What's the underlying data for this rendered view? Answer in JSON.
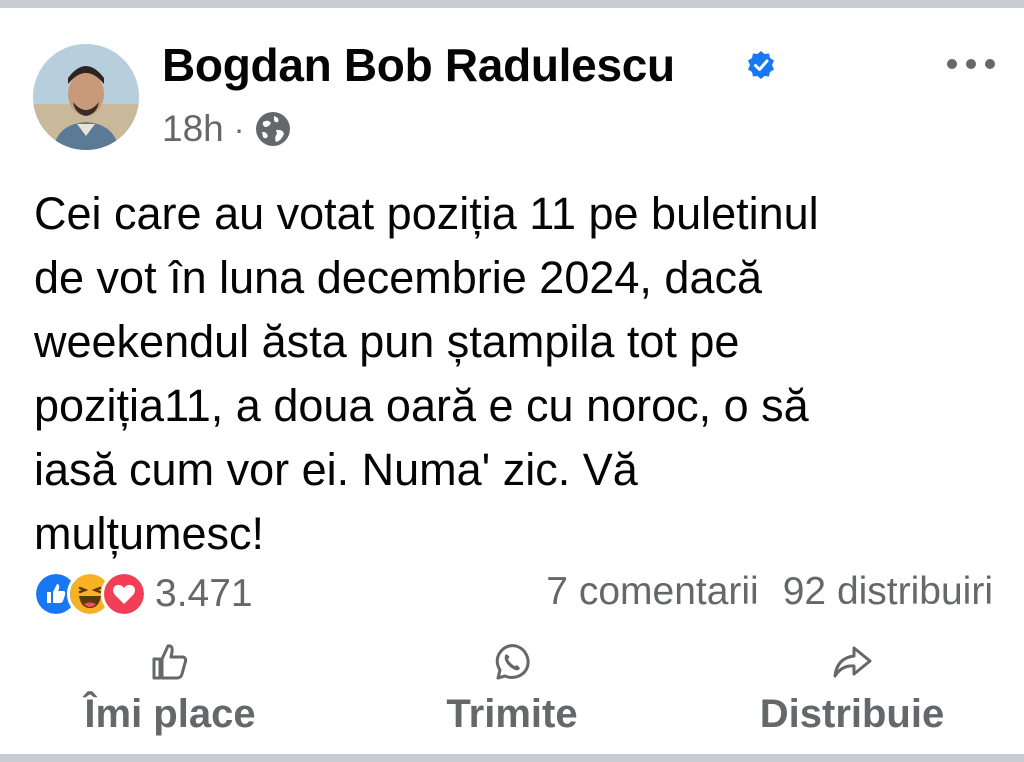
{
  "post": {
    "author": "Bogdan Bob Radulescu",
    "verified": true,
    "time": "18h",
    "separator": "·",
    "privacy_icon": "globe-icon",
    "menu_icon": "more-options-icon",
    "text": "Cei care au votat poziția 11 pe buletinul\nde vot în luna decembrie 2024, dacă\nweekendul ăsta pun ștampila tot pe\npoziția11, a doua oară e cu noroc, o să\niasă cum vor ei. Numa' zic. Vă\nmulțumesc!"
  },
  "stats": {
    "reactions": [
      "like",
      "haha",
      "love"
    ],
    "reaction_count": "3.471",
    "comments": "7 comentarii",
    "shares": "92 distribuiri"
  },
  "actions": [
    {
      "label": "Îmi place",
      "icon": "thumbs-up-icon"
    },
    {
      "label": "Trimite",
      "icon": "whatsapp-icon"
    },
    {
      "label": "Distribuie",
      "icon": "share-arrow-icon"
    }
  ],
  "colors": {
    "verified": "#1877f2",
    "secondary_text": "#65676b",
    "like": "#1877f2",
    "love": "#f33e58",
    "haha": "#f7b125",
    "separator": "#c9ccd1"
  }
}
